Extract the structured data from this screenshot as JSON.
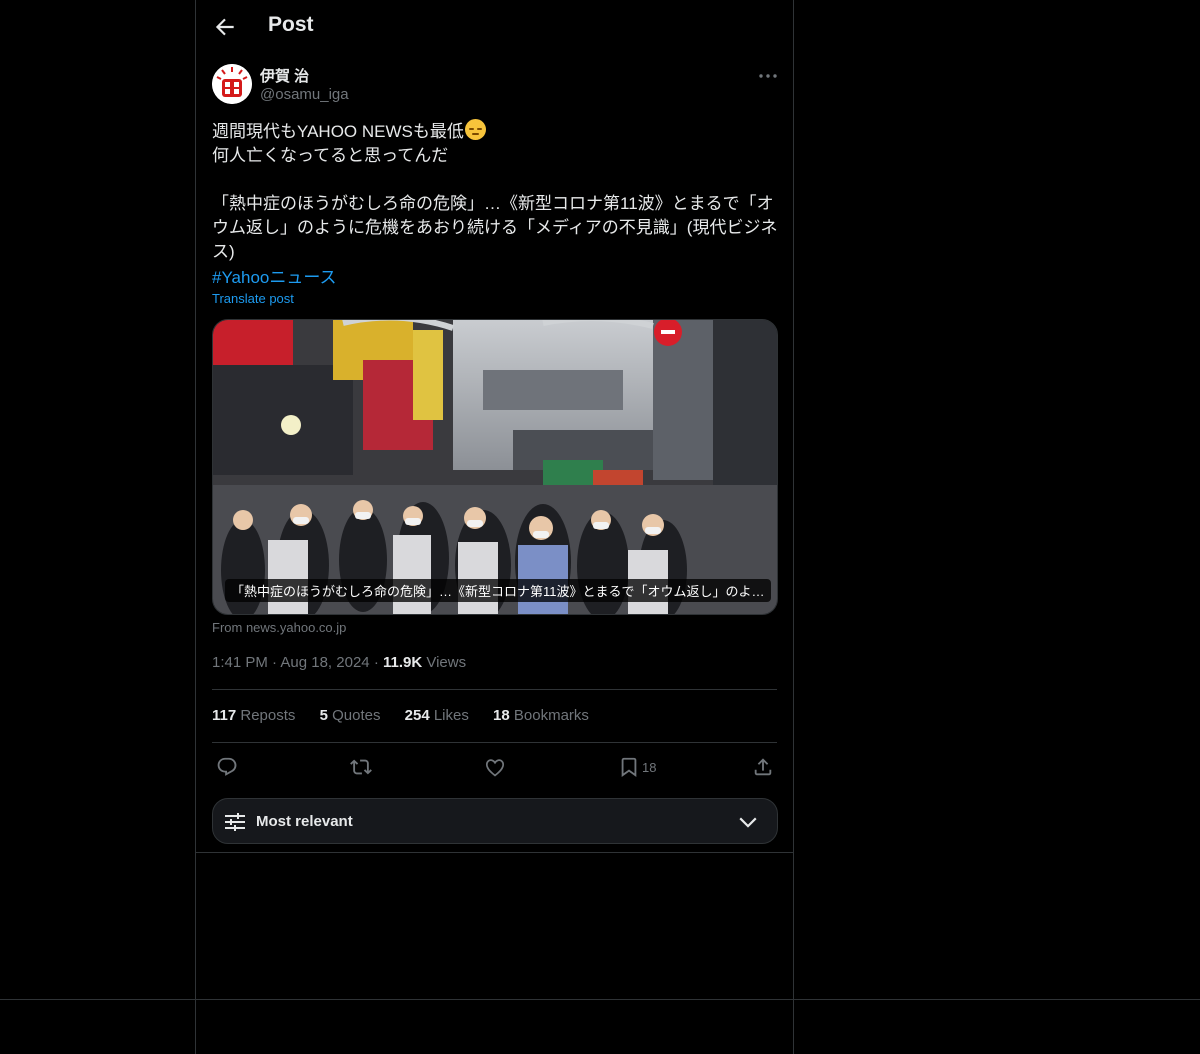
{
  "header": {
    "title": "Post"
  },
  "author": {
    "name": "伊賀 治",
    "handle": "@osamu_iga"
  },
  "post": {
    "text": "週間現代もYAHOO NEWSも最低",
    "text_line2": "何人亡くなってると思ってんだ",
    "text_quote": "「熱中症のほうがむしろ命の危険」…《新型コロナ第11波》とまるで「オウム返し」のように危機をあおり続ける「メディアの不見識」(現代ビジネス)",
    "hashtag": "#Yahooニュース",
    "translate_label": "Translate post",
    "card_caption": "「熱中症のほうがむしろ命の危険」…《新型コロナ第11波》とまるで「オウム返し」のよ…",
    "card_source": "From news.yahoo.co.jp",
    "time": "1:41 PM",
    "date": "Aug 18, 2024",
    "views_count": "11.9K",
    "views_label": "Views"
  },
  "stats": {
    "reposts_count": "117",
    "reposts_label": "Reposts",
    "quotes_count": "5",
    "quotes_label": "Quotes",
    "likes_count": "254",
    "likes_label": "Likes",
    "bookmarks_count": "18",
    "bookmarks_label": "Bookmarks"
  },
  "actions": {
    "bookmark_count": "18"
  },
  "sort": {
    "label": "Most relevant"
  },
  "icons": [
    "back-arrow-icon",
    "more-icon",
    "reply-icon",
    "repost-icon",
    "like-icon",
    "bookmark-icon",
    "share-icon",
    "sliders-icon",
    "chevron-down-icon"
  ],
  "colors": {
    "background": "#000000",
    "text": "#e7e9ea",
    "muted": "#71767b",
    "link": "#1d9bf0",
    "border": "#2f3336"
  }
}
